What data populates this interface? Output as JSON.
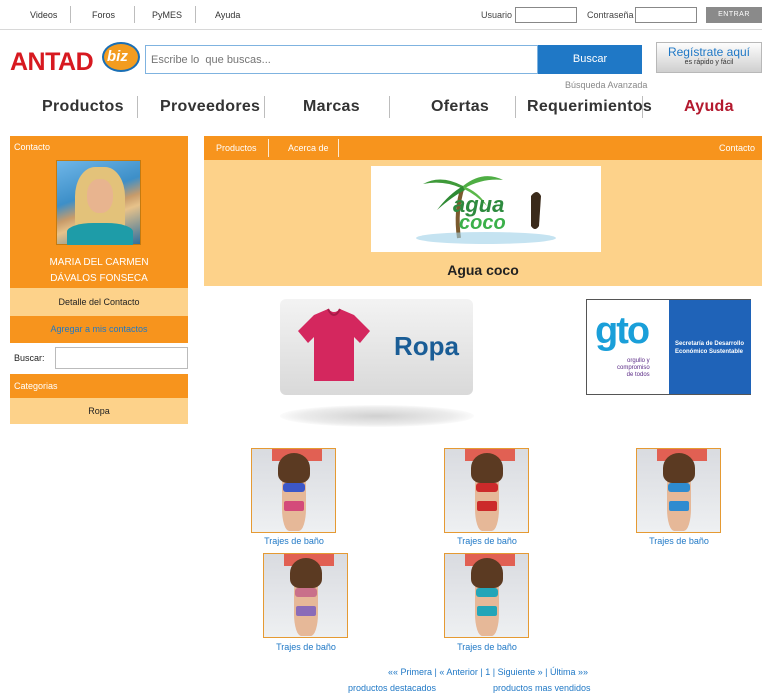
{
  "topbar": {
    "links": [
      "Videos",
      "Foros",
      "PyMES",
      "Ayuda"
    ],
    "usuario_label": "Usuario",
    "password_label": "Contraseña",
    "entrar_label": "ENTRAR"
  },
  "header": {
    "logo_word": "ANTAD",
    "logo_suffix": "biz",
    "search_placeholder": "Escribe lo  que buscas...",
    "search_button": "Buscar",
    "advanced_search": "Búsqueda Avanzada",
    "register_title": "Regístrate aquí",
    "register_subtitle": "es rápido y fácil"
  },
  "nav": {
    "items": [
      "Productos",
      "Proveedores",
      "Marcas",
      "Ofertas",
      "Requerimientos",
      "Ayuda"
    ],
    "active_color": "#b3192e"
  },
  "sidebar": {
    "contact_title": "Contacto",
    "contact_name_1": "MARIA DEL CARMEN",
    "contact_name_2": "DÁVALOS FONSECA",
    "detail_label": "Detalle del Contacto",
    "add_label": "Agregar a mis contactos",
    "search_label": "Buscar:",
    "categories_title": "Categorias",
    "categories": [
      "Ropa"
    ]
  },
  "store": {
    "tabs": [
      "Productos",
      "Acerca de"
    ],
    "contact_tab": "Contacto",
    "brand_logo_text_1": "agua",
    "brand_logo_text_2": "coco",
    "name": "Agua coco",
    "category_banner": "Ropa",
    "sponsor_logo": "gto",
    "sponsor_tagline": [
      "orgullo y",
      "compromiso",
      "de todos"
    ],
    "sponsor_secretaria": [
      "Secretaría de Desarrollo",
      "Económico Sustentable"
    ]
  },
  "products": [
    {
      "label": "Trajes de baño",
      "top": "#3c57c8",
      "bottom": "#d44a7a"
    },
    {
      "label": "Trajes de baño",
      "top": "#cc2a2a",
      "bottom": "#cc2a2a"
    },
    {
      "label": "Trajes de baño",
      "top": "#2e8bd0",
      "bottom": "#2e8bd0"
    },
    {
      "label": "Trajes de baño",
      "top": "#c9708a",
      "bottom": "#8a6bb8"
    },
    {
      "label": "Trajes de baño",
      "top": "#23a5b8",
      "bottom": "#23a5b8"
    }
  ],
  "pager": {
    "first": "«« Primera",
    "prev": "« Anterior",
    "page": "1",
    "next": "Siguiente »",
    "last": "Última »»",
    "featured": "productos destacados",
    "best_sellers": "productos mas vendidos"
  },
  "colors": {
    "orange": "#f7941d",
    "light_orange": "#fdd28a",
    "link_blue": "#1f78c6"
  }
}
